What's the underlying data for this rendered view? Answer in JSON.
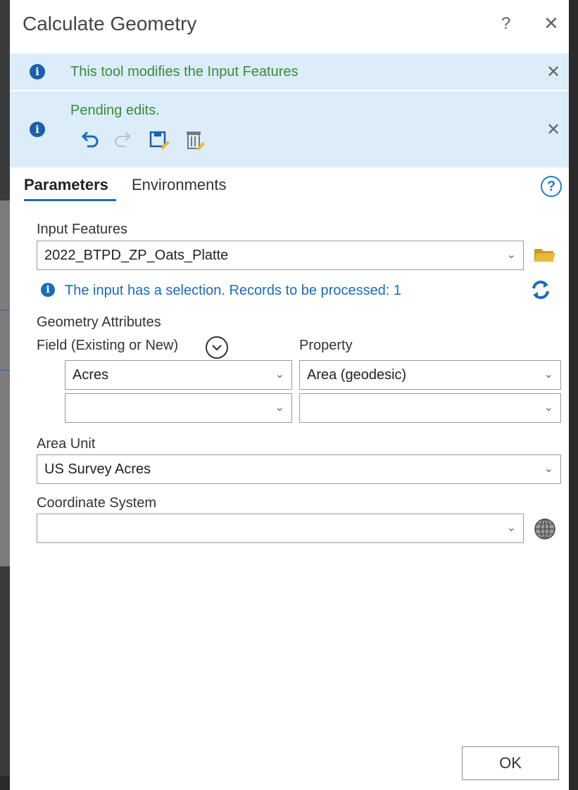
{
  "window": {
    "title": "Calculate Geometry",
    "help_label": "?",
    "close_label": "✕"
  },
  "banners": {
    "modifies": {
      "text": "This tool modifies the Input Features",
      "close_label": "✕"
    },
    "pending": {
      "text": "Pending edits.",
      "close_label": "✕"
    }
  },
  "tabs": [
    {
      "label": "Parameters",
      "active": true
    },
    {
      "label": "Environments",
      "active": false
    }
  ],
  "form": {
    "input_features": {
      "label": "Input Features",
      "value": "2022_BTPD_ZP_Oats_Platte"
    },
    "selection_notice": "The input has a selection. Records to be processed: 1",
    "geometry_attributes": {
      "label": "Geometry Attributes",
      "field_header": "Field (Existing or New)",
      "property_header": "Property",
      "rows": [
        {
          "field": "Acres",
          "property": "Area (geodesic)"
        },
        {
          "field": "",
          "property": ""
        }
      ]
    },
    "area_unit": {
      "label": "Area Unit",
      "value": "US Survey Acres"
    },
    "coordinate_system": {
      "label": "Coordinate System",
      "value": ""
    }
  },
  "actions": {
    "ok_label": "OK"
  },
  "icons": {
    "info": "info-icon",
    "undo": "undo-icon",
    "redo": "redo-icon",
    "save_edits": "save-edits-icon",
    "discard_edits": "discard-edits-icon",
    "folder": "folder-icon",
    "refresh": "refresh-icon",
    "globe": "globe-icon",
    "expand": "chevron-down-circle-icon"
  },
  "colors": {
    "banner_bg": "#dcedf9",
    "banner_text": "#3a8a3a",
    "accent_blue": "#1a6bbf",
    "folder_yellow": "#e8b93a"
  }
}
